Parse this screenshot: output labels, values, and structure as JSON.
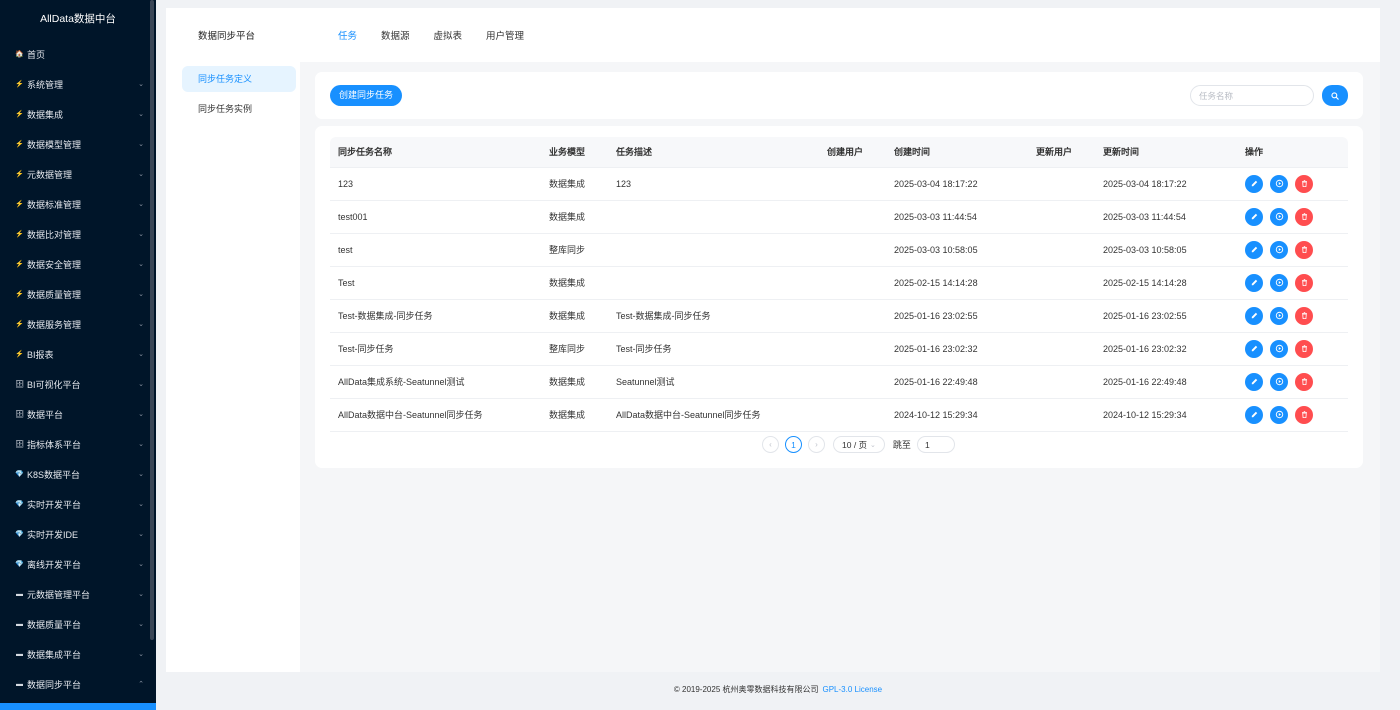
{
  "app": {
    "title": "AllData数据中台"
  },
  "sidebar": {
    "items": [
      {
        "label": "首页",
        "icon": "🏠",
        "arrow": ""
      },
      {
        "label": "系统管理",
        "icon": "⚡",
        "arrow": "⌄"
      },
      {
        "label": "数据集成",
        "icon": "⚡",
        "arrow": "⌄"
      },
      {
        "label": "数据模型管理",
        "icon": "⚡",
        "arrow": "⌄"
      },
      {
        "label": "元数据管理",
        "icon": "⚡",
        "arrow": "⌄"
      },
      {
        "label": "数据标准管理",
        "icon": "⚡",
        "arrow": "⌄"
      },
      {
        "label": "数据比对管理",
        "icon": "⚡",
        "arrow": "⌄"
      },
      {
        "label": "数据安全管理",
        "icon": "⚡",
        "arrow": "⌄"
      },
      {
        "label": "数据质量管理",
        "icon": "⚡",
        "arrow": "⌄"
      },
      {
        "label": "数据服务管理",
        "icon": "⚡",
        "arrow": "⌄"
      },
      {
        "label": "BI报表",
        "icon": "⚡",
        "arrow": "⌄"
      },
      {
        "label": "BI可视化平台",
        "icon": "🗄",
        "arrow": "⌄"
      },
      {
        "label": "数据平台",
        "icon": "🗄",
        "arrow": "⌄"
      },
      {
        "label": "指标体系平台",
        "icon": "🗄",
        "arrow": "⌄"
      },
      {
        "label": "K8S数据平台",
        "icon": "💎",
        "arrow": "⌄"
      },
      {
        "label": "实时开发平台",
        "icon": "💎",
        "arrow": "⌄"
      },
      {
        "label": "实时开发IDE",
        "icon": "💎",
        "arrow": "⌄"
      },
      {
        "label": "离线开发平台",
        "icon": "💎",
        "arrow": "⌄"
      },
      {
        "label": "元数据管理平台",
        "icon": "▬",
        "arrow": "⌄"
      },
      {
        "label": "数据质量平台",
        "icon": "▬",
        "arrow": "⌄"
      },
      {
        "label": "数据集成平台",
        "icon": "▬",
        "arrow": "⌄"
      },
      {
        "label": "数据同步平台",
        "icon": "▬",
        "arrow": "⌃"
      }
    ]
  },
  "header": {
    "system_title": "数据同步平台",
    "tabs": [
      {
        "label": "任务",
        "active": true
      },
      {
        "label": "数据源",
        "active": false
      },
      {
        "label": "虚拟表",
        "active": false
      },
      {
        "label": "用户管理",
        "active": false
      }
    ]
  },
  "submenu": {
    "items": [
      {
        "label": "同步任务定义",
        "active": true
      },
      {
        "label": "同步任务实例",
        "active": false
      }
    ]
  },
  "toolbar": {
    "create_label": "创建同步任务",
    "search_placeholder": "任务名称"
  },
  "table": {
    "columns": [
      "同步任务名称",
      "业务模型",
      "任务描述",
      "创建用户",
      "创建时间",
      "更新用户",
      "更新时间",
      "操作"
    ],
    "rows": [
      {
        "name": "123",
        "model": "数据集成",
        "desc": "123",
        "creator": "",
        "created": "2025-03-04 18:17:22",
        "updater": "",
        "updated": "2025-03-04 18:17:22"
      },
      {
        "name": "test001",
        "model": "数据集成",
        "desc": "",
        "creator": "",
        "created": "2025-03-03 11:44:54",
        "updater": "",
        "updated": "2025-03-03 11:44:54"
      },
      {
        "name": "test",
        "model": "整库同步",
        "desc": "",
        "creator": "",
        "created": "2025-03-03 10:58:05",
        "updater": "",
        "updated": "2025-03-03 10:58:05"
      },
      {
        "name": "Test",
        "model": "数据集成",
        "desc": "",
        "creator": "",
        "created": "2025-02-15 14:14:28",
        "updater": "",
        "updated": "2025-02-15 14:14:28"
      },
      {
        "name": "Test-数据集成-同步任务",
        "model": "数据集成",
        "desc": "Test-数据集成-同步任务",
        "creator": "",
        "created": "2025-01-16 23:02:55",
        "updater": "",
        "updated": "2025-01-16 23:02:55"
      },
      {
        "name": "Test-同步任务",
        "model": "整库同步",
        "desc": "Test-同步任务",
        "creator": "",
        "created": "2025-01-16 23:02:32",
        "updater": "",
        "updated": "2025-01-16 23:02:32"
      },
      {
        "name": "AllData集成系统-Seatunnel测试",
        "model": "数据集成",
        "desc": "Seatunnel测试",
        "creator": "",
        "created": "2025-01-16 22:49:48",
        "updater": "",
        "updated": "2025-01-16 22:49:48"
      },
      {
        "name": "AllData数据中台-Seatunnel同步任务",
        "model": "数据集成",
        "desc": "AllData数据中台-Seatunnel同步任务",
        "creator": "",
        "created": "2024-10-12 15:29:34",
        "updater": "",
        "updated": "2024-10-12 15:29:34"
      }
    ]
  },
  "pagination": {
    "prev": "‹",
    "next": "›",
    "current_page": "1",
    "page_size": "10 / 页",
    "jump_label": "跳至",
    "jump_value": "1"
  },
  "footer": {
    "copyright": "© 2019-2025 杭州奥零数据科技有限公司",
    "license": "GPL-3.0 License"
  },
  "colors": {
    "primary": "#1890ff",
    "danger": "#ff4d4f",
    "sidebar_bg": "#001529"
  }
}
